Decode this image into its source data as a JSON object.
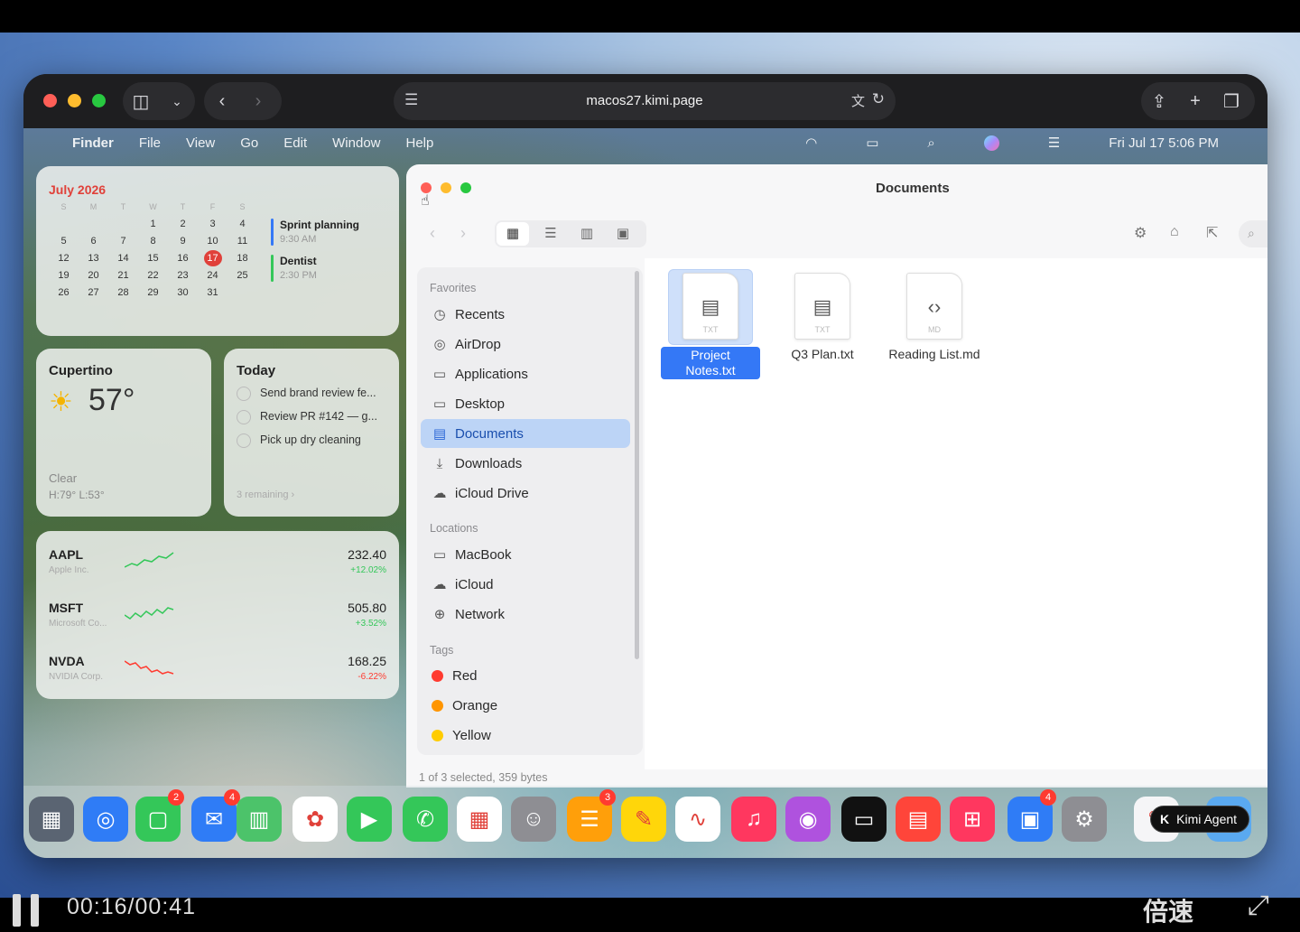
{
  "browser": {
    "url": "macos27.kimi.page"
  },
  "menubar": {
    "items": [
      "Finder",
      "File",
      "View",
      "Go",
      "Edit",
      "Window",
      "Help"
    ],
    "clock": "Fri Jul 17  5:06 PM"
  },
  "calendar": {
    "month": "July 2026",
    "weekdays": [
      "S",
      "M",
      "T",
      "W",
      "T",
      "F",
      "S"
    ],
    "weeks": [
      [
        "",
        "",
        "",
        "1",
        "2",
        "3",
        "4"
      ],
      [
        "5",
        "6",
        "7",
        "8",
        "9",
        "10",
        "11"
      ],
      [
        "12",
        "13",
        "14",
        "15",
        "16",
        "17",
        "18"
      ],
      [
        "19",
        "20",
        "21",
        "22",
        "23",
        "24",
        "25"
      ],
      [
        "26",
        "27",
        "28",
        "29",
        "30",
        "31",
        ""
      ]
    ],
    "today": "17",
    "events": [
      {
        "title": "Sprint planning",
        "time": "9:30 AM",
        "color": "#3478f6"
      },
      {
        "title": "Dentist",
        "time": "2:30 PM",
        "color": "#34c759"
      }
    ]
  },
  "weather": {
    "city": "Cupertino",
    "temp": "57°",
    "condition": "Clear",
    "range": "H:79° L:53°"
  },
  "reminders": {
    "title": "Today",
    "items": [
      "Send brand review fe...",
      "Review PR #142 — g...",
      "Pick up dry cleaning"
    ],
    "footer": "3 remaining  ›"
  },
  "stocks": [
    {
      "symbol": "AAPL",
      "name": "Apple Inc.",
      "price": "232.40",
      "change": "+12.02%",
      "color": "#34c759"
    },
    {
      "symbol": "MSFT",
      "name": "Microsoft Co...",
      "price": "505.80",
      "change": "+3.52%",
      "color": "#34c759"
    },
    {
      "symbol": "NVDA",
      "name": "NVIDIA Corp.",
      "price": "168.25",
      "change": "-6.22%",
      "color": "#ff3b30"
    }
  ],
  "finder": {
    "title": "Documents",
    "favorites_label": "Favorites",
    "favorites": [
      {
        "label": "Recents",
        "icon": "clock-icon",
        "glyph": "◷"
      },
      {
        "label": "AirDrop",
        "icon": "airdrop-icon",
        "glyph": "◎"
      },
      {
        "label": "Applications",
        "icon": "applications-icon",
        "glyph": "▭"
      },
      {
        "label": "Desktop",
        "icon": "desktop-icon",
        "glyph": "▭"
      },
      {
        "label": "Documents",
        "icon": "document-icon",
        "glyph": "▤"
      },
      {
        "label": "Downloads",
        "icon": "download-icon",
        "glyph": "⤓"
      },
      {
        "label": "iCloud Drive",
        "icon": "cloud-icon",
        "glyph": "☁"
      }
    ],
    "selected": "Documents",
    "locations_label": "Locations",
    "locations": [
      {
        "label": "MacBook",
        "icon": "drive-icon",
        "glyph": "▭"
      },
      {
        "label": "iCloud",
        "icon": "cloud-icon",
        "glyph": "☁"
      },
      {
        "label": "Network",
        "icon": "globe-icon",
        "glyph": "⊕"
      }
    ],
    "tags_label": "Tags",
    "tags": [
      {
        "label": "Red",
        "color": "#ff3b30"
      },
      {
        "label": "Orange",
        "color": "#ff9500"
      },
      {
        "label": "Yellow",
        "color": "#ffcc00"
      }
    ],
    "files": [
      {
        "name": "Project Notes.txt",
        "ext": "TXT",
        "glyph": "▤",
        "selected": true
      },
      {
        "name": "Q3 Plan.txt",
        "ext": "TXT",
        "glyph": "▤",
        "selected": false
      },
      {
        "name": "Reading List.md",
        "ext": "MD",
        "glyph": "‹›",
        "selected": false
      }
    ],
    "status": "1 of 3 selected, 359 bytes"
  },
  "dock": {
    "apps": [
      {
        "name": "launchpad",
        "glyph": "▦",
        "bg": "#5a6472"
      },
      {
        "name": "safari",
        "glyph": "◎",
        "bg": "#2f7cf6"
      },
      {
        "name": "messages",
        "glyph": "▢",
        "bg": "#34c759",
        "badge": "2"
      },
      {
        "name": "mail",
        "glyph": "✉",
        "bg": "#2f7cf6",
        "badge": "4"
      },
      {
        "name": "maps",
        "glyph": "▥",
        "bg": "#4cc36a"
      },
      {
        "name": "photos",
        "glyph": "✿",
        "bg": "#ffffff"
      },
      {
        "name": "facetime",
        "glyph": "▶",
        "bg": "#34c759"
      },
      {
        "name": "phone",
        "glyph": "✆",
        "bg": "#34c759"
      },
      {
        "name": "calendar",
        "glyph": "▦",
        "bg": "#ffffff"
      },
      {
        "name": "contacts",
        "glyph": "☺",
        "bg": "#8e8e93"
      },
      {
        "name": "reminders",
        "glyph": "☰",
        "bg": "#ff9f0a",
        "badge": "3"
      },
      {
        "name": "notes",
        "glyph": "✎",
        "bg": "#ffd60a"
      },
      {
        "name": "freeform",
        "glyph": "∿",
        "bg": "#ffffff"
      },
      {
        "name": "music",
        "glyph": "♫",
        "bg": "#ff375f"
      },
      {
        "name": "podcasts",
        "glyph": "◉",
        "bg": "#af52de"
      },
      {
        "name": "tv",
        "glyph": "▭",
        "bg": "#111111"
      },
      {
        "name": "news",
        "glyph": "▤",
        "bg": "#ff453a"
      },
      {
        "name": "arcade",
        "glyph": "⊞",
        "bg": "#ff375f"
      },
      {
        "name": "app-store",
        "glyph": "▣",
        "bg": "#2f7cf6",
        "badge": "4"
      },
      {
        "name": "settings",
        "glyph": "⚙",
        "bg": "#8e8e93"
      },
      {
        "name": "textedit",
        "glyph": "✎",
        "bg": "#f5f5f7"
      },
      {
        "name": "folder",
        "glyph": "▬",
        "bg": "#5aa9f0"
      }
    ],
    "kimi_label": "Kimi Agent"
  },
  "player": {
    "time": "00:16/00:41",
    "speed_label": "倍速"
  }
}
